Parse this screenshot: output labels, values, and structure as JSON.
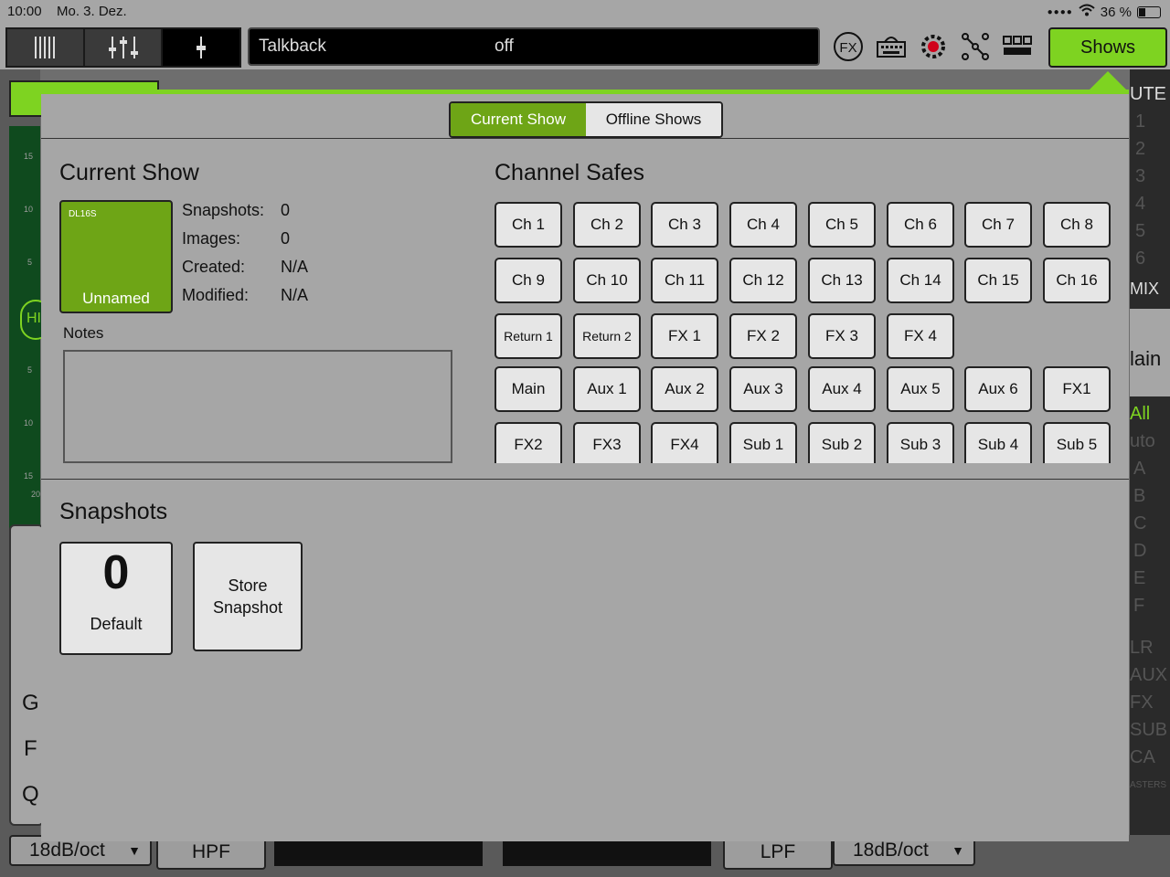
{
  "status": {
    "time": "10:00",
    "date": "Mo. 3. Dez.",
    "battery": "36 %"
  },
  "toolbar": {
    "talkback_label": "Talkback",
    "talkback_value": "off",
    "shows_label": "Shows",
    "fx_icon_label": "FX"
  },
  "background": {
    "bottom_left_slope": "18dB/oct",
    "hpf_label": "HPF",
    "lpf_label": "LPF",
    "bottom_right_slope": "18dB/oct",
    "right_labels": [
      "UTE",
      "1",
      "2",
      "3",
      "4",
      "5",
      "6",
      "MIX",
      "lain",
      "All",
      "uto",
      "A",
      "B",
      "C",
      "D",
      "E",
      "F",
      "LR",
      "AUX",
      "FX",
      "SUB",
      "CA",
      "ASTERS"
    ],
    "left_labels": [
      "15",
      "10",
      "5",
      "HI",
      "5",
      "10",
      "15",
      "20",
      "G",
      "F",
      "Q"
    ]
  },
  "tabs": {
    "current": "Current Show",
    "offline": "Offline Shows"
  },
  "current_show": {
    "heading": "Current Show",
    "model": "DL16S",
    "name": "Unnamed",
    "snapshots_label": "Snapshots:",
    "snapshots_value": "0",
    "images_label": "Images:",
    "images_value": "0",
    "created_label": "Created:",
    "created_value": "N/A",
    "modified_label": "Modified:",
    "modified_value": "N/A",
    "notes_label": "Notes"
  },
  "channel_safes": {
    "heading": "Channel Safes",
    "rows": [
      [
        "Ch 1",
        "Ch 2",
        "Ch 3",
        "Ch 4",
        "Ch 5",
        "Ch 6",
        "Ch 7",
        "Ch 8"
      ],
      [
        "Ch 9",
        "Ch 10",
        "Ch 11",
        "Ch 12",
        "Ch 13",
        "Ch 14",
        "Ch 15",
        "Ch 16"
      ],
      [
        "Return 1",
        "Return 2",
        "FX 1",
        "FX 2",
        "FX 3",
        "FX 4"
      ],
      [
        "Main",
        "Aux 1",
        "Aux 2",
        "Aux 3",
        "Aux 4",
        "Aux 5",
        "Aux 6",
        "FX1"
      ],
      [
        "FX2",
        "FX3",
        "FX4",
        "Sub 1",
        "Sub 2",
        "Sub 3",
        "Sub 4",
        "Sub 5"
      ]
    ]
  },
  "snapshots": {
    "heading": "Snapshots",
    "default_number": "0",
    "default_label": "Default",
    "store_label": "Store Snapshot"
  }
}
